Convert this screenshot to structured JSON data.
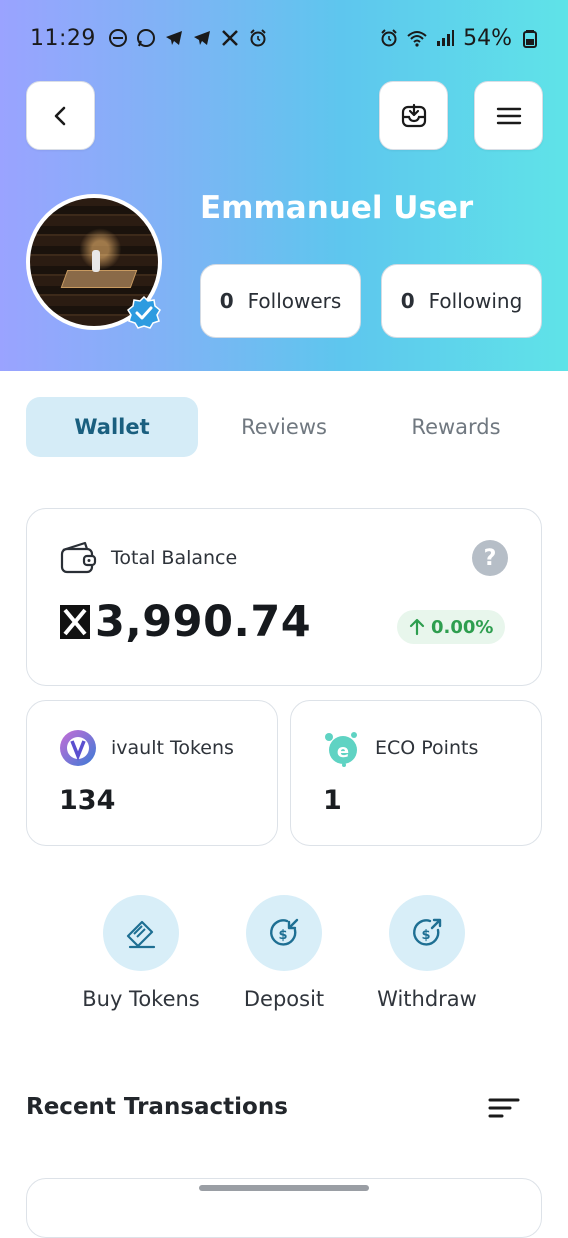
{
  "status_bar": {
    "time": "11:29",
    "battery": "54%"
  },
  "profile": {
    "name": "Emmanuel User",
    "followers_count": "0",
    "followers_label": "Followers",
    "following_count": "0",
    "following_label": "Following",
    "verified": true
  },
  "tabs": [
    {
      "label": "Wallet",
      "active": true
    },
    {
      "label": "Reviews",
      "active": false
    },
    {
      "label": "Rewards",
      "active": false
    }
  ],
  "balance": {
    "label": "Total Balance",
    "amount": "3,990.74",
    "change": "0.00%",
    "help": "?"
  },
  "tokens": [
    {
      "label": "ivault Tokens",
      "value": "134",
      "icon": "ivault-token-icon"
    },
    {
      "label": "ECO Points",
      "value": "1",
      "icon": "eco-points-icon"
    }
  ],
  "actions": [
    {
      "label": "Buy Tokens",
      "icon": "ticket-icon"
    },
    {
      "label": "Deposit",
      "icon": "deposit-icon"
    },
    {
      "label": "Withdraw",
      "icon": "withdraw-icon"
    }
  ],
  "recent": {
    "title": "Recent Transactions"
  },
  "colors": {
    "accent": "#1a5f7f",
    "tab_active_bg": "#d5ecf7",
    "positive": "#2e9e4f",
    "action_circle": "#d8eef8"
  }
}
